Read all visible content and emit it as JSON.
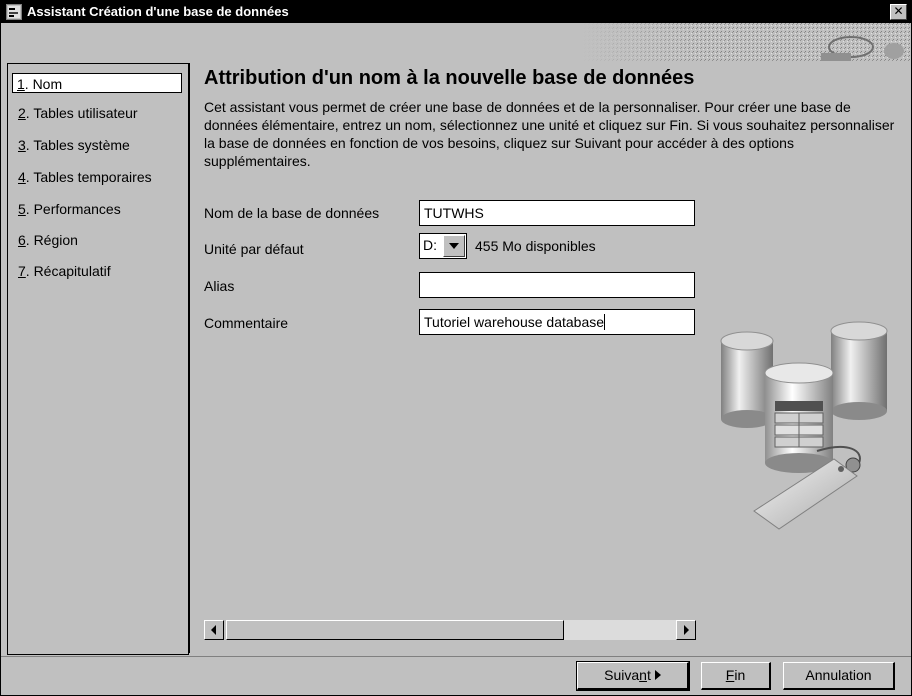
{
  "window": {
    "title": "Assistant Création d'une base de données",
    "close_glyph": "✕",
    "icon": "db-wizard-icon"
  },
  "nav": {
    "items": [
      {
        "num": "1",
        "label": ". Nom",
        "selected": true
      },
      {
        "num": "2",
        "label": ". Tables utilisateur",
        "selected": false
      },
      {
        "num": "3",
        "label": ". Tables système",
        "selected": false
      },
      {
        "num": "4",
        "label": ". Tables temporaires",
        "selected": false
      },
      {
        "num": "5",
        "label": ". Performances",
        "selected": false
      },
      {
        "num": "6",
        "label": ". Région",
        "selected": false
      },
      {
        "num": "7",
        "label": ". Récapitulatif",
        "selected": false
      }
    ]
  },
  "page": {
    "heading": "Attribution d'un nom à la nouvelle base de données",
    "description": "Cet assistant vous permet de créer une base de données et de la personnaliser. Pour créer une base de données élémentaire, entrez un nom, sélectionnez une unité et cliquez sur Fin. Si vous souhaitez personnaliser la base de données en fonction de vos besoins, cliquez sur Suivant pour accéder à des options supplémentaires."
  },
  "form": {
    "db_name_label": "Nom de la base de données",
    "db_name_value": "TUTWHS",
    "drive_label": "Unité par défaut",
    "drive_value": "D:",
    "drive_available": "455  Mo disponibles",
    "alias_label": "Alias",
    "alias_value": "",
    "comment_label": "Commentaire",
    "comment_value": "Tutoriel warehouse database"
  },
  "buttons": {
    "next_pre": "Suiva",
    "next_mnemonic": "n",
    "next_post": "t",
    "finish_mnemonic": "F",
    "finish_post": "in",
    "cancel": "Annulation"
  },
  "colors": {
    "titlebar": "#000000",
    "window_bg": "#c0c0c0",
    "field_bg": "#ffffff"
  }
}
